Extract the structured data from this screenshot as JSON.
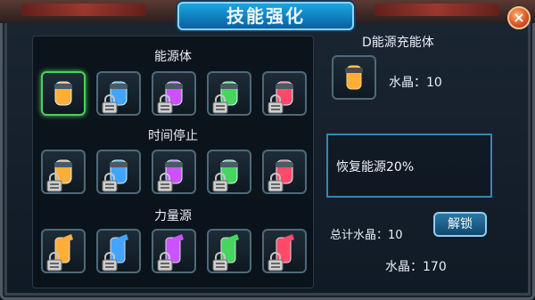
{
  "title": "技能强化",
  "close_label": "×",
  "sections": [
    {
      "title": "能源体",
      "icons": [
        "energy-orange",
        "energy-blue",
        "energy-purple",
        "energy-green",
        "energy-red"
      ],
      "locked": [
        false,
        true,
        true,
        true,
        true
      ]
    },
    {
      "title": "时间停止",
      "icons": [
        "time-orange",
        "time-blue",
        "time-purple",
        "time-green",
        "time-red"
      ],
      "locked": [
        true,
        true,
        true,
        true,
        true
      ]
    },
    {
      "title": "力量源",
      "icons": [
        "power-orange",
        "power-blue",
        "power-purple",
        "power-green",
        "power-red"
      ],
      "locked": [
        true,
        true,
        true,
        true,
        true
      ]
    }
  ],
  "detail": {
    "title": "D能源充能体",
    "crystal": "水晶：10",
    "description": "恢复能源20%",
    "total": "总计水晶：10",
    "unlock": "解锁",
    "balance": "水晶：170"
  }
}
